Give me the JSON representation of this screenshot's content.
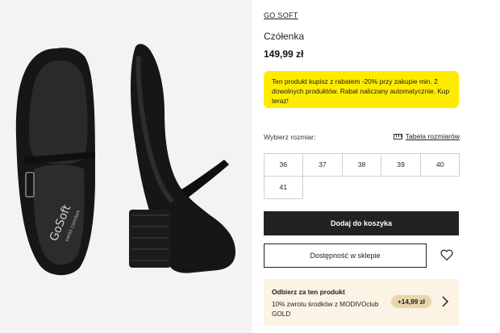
{
  "gallery": {
    "insole_brand": "GoSoft",
    "insole_tagline": "swiss comfort"
  },
  "product": {
    "brand": "GO SOFT",
    "title": "Czółenka",
    "price": "149,99 zł"
  },
  "promo": {
    "text": "Ten produkt kupisz z rabatem -20% przy zakupie min. 2 dowolnych produktów. Rabat naliczany automatycznie. Kup teraz!",
    "background": "#ffeb00"
  },
  "sizes": {
    "label": "Wybierz rozmiar:",
    "table_link": "Tabela rozmiarów",
    "options": [
      "36",
      "37",
      "38",
      "39",
      "40",
      "41"
    ]
  },
  "actions": {
    "add_to_cart": "Dodaj do koszyka",
    "availability": "Dostępność w sklepie",
    "wishlist_icon": "heart-icon"
  },
  "reward": {
    "title": "Odbierz za ten produkt",
    "description": "10% zwrotu środków z MODIVOclub GOLD",
    "amount": "+14,99 zł",
    "background": "#fbf3e3"
  }
}
